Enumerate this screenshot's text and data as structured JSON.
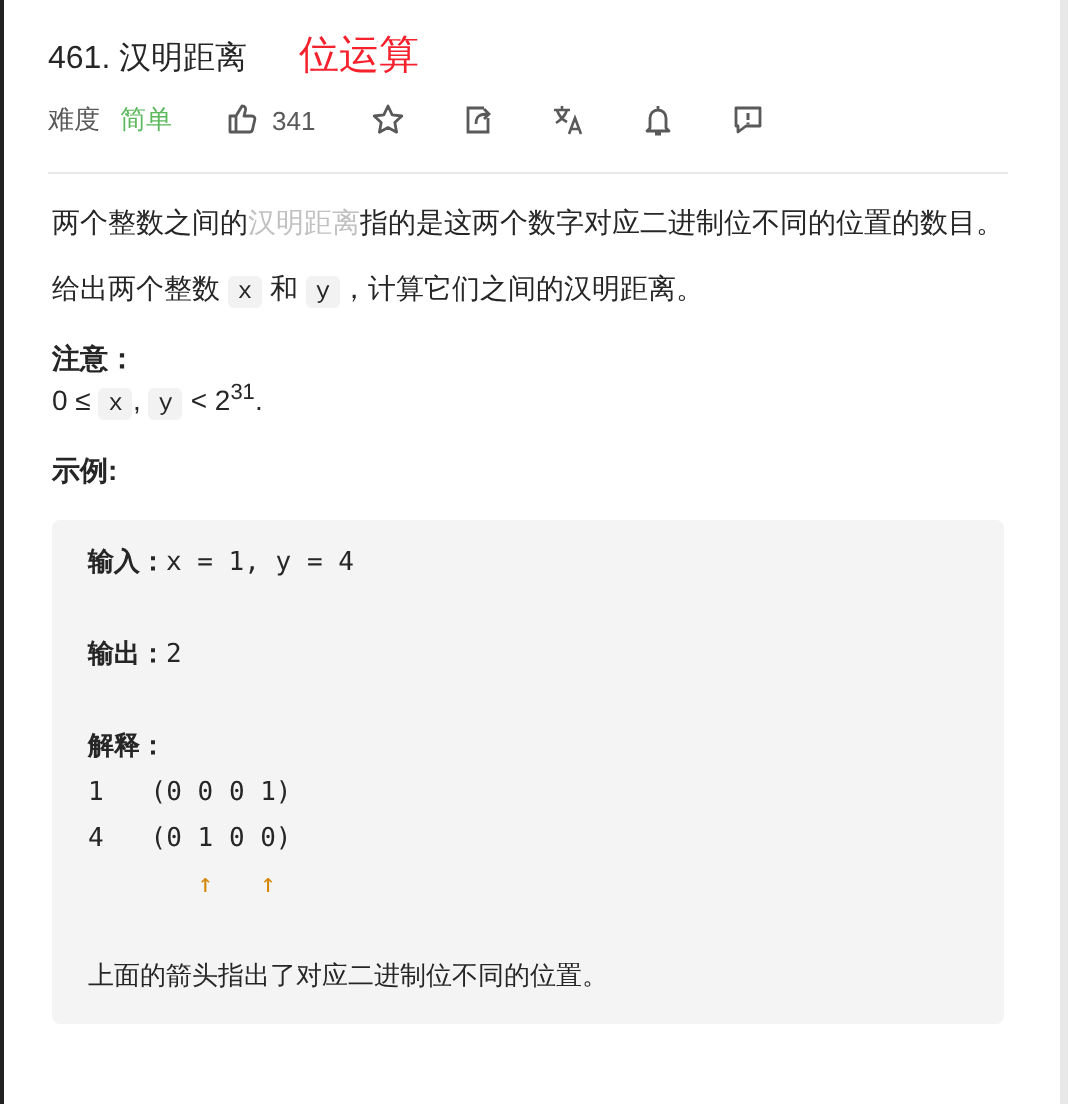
{
  "problem": {
    "title": "461. 汉明距离",
    "tag": "位运算",
    "difficulty_label": "难度",
    "difficulty": "简单",
    "likes": "341"
  },
  "description": [
    {
      "kind": "paragraph",
      "segments": [
        {
          "kind": "text",
          "text": "两个整数之间的"
        },
        {
          "kind": "link",
          "text": "汉明距离"
        },
        {
          "kind": "text",
          "text": "指的是这两个数字对应二进制位不同的位置的数目。"
        }
      ]
    },
    {
      "kind": "paragraph",
      "segments": [
        {
          "kind": "text",
          "text": "给出两个整数 "
        },
        {
          "kind": "code",
          "text": "x"
        },
        {
          "kind": "text",
          "text": " 和 "
        },
        {
          "kind": "code",
          "text": "y"
        },
        {
          "kind": "text",
          "text": "，计算它们之间的汉明距离。"
        }
      ]
    },
    {
      "kind": "heading",
      "text": "注意："
    },
    {
      "kind": "paragraph",
      "segments": [
        {
          "kind": "text",
          "text": "0 ≤ "
        },
        {
          "kind": "code",
          "text": "x"
        },
        {
          "kind": "text",
          "text": ", "
        },
        {
          "kind": "code",
          "text": "y"
        },
        {
          "kind": "text",
          "text": " < 2$^{31}$."
        }
      ]
    },
    {
      "kind": "heading",
      "text": "示例:"
    }
  ],
  "example": [
    {
      "kind": "labeled",
      "label": "输入：",
      "text": "x = 1, y = 4"
    },
    {
      "kind": "blank"
    },
    {
      "kind": "labeled",
      "label": "输出：",
      "text": "2"
    },
    {
      "kind": "blank"
    },
    {
      "kind": "label",
      "label": "解释："
    },
    {
      "kind": "code",
      "text": "1   (0 0 0 1)"
    },
    {
      "kind": "code",
      "text": "4   (0 1 0 0)"
    },
    {
      "kind": "arrows",
      "text": "       ↑   ↑"
    },
    {
      "kind": "blank"
    },
    {
      "kind": "note",
      "text": "上面的箭头指出了对应二进制位不同的位置。"
    }
  ]
}
